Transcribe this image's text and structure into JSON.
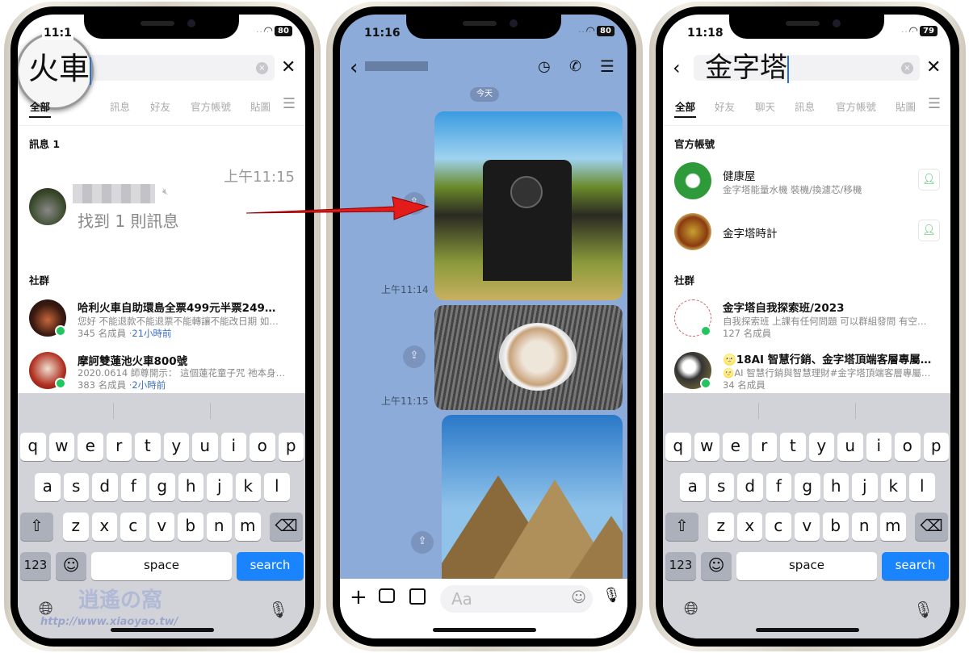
{
  "left": {
    "time": "11:1",
    "battery": "80",
    "query": "火車",
    "tabs": [
      "全部",
      "訊息",
      "好友",
      "官方帳號",
      "貼圖"
    ],
    "messages_header": "訊息 1",
    "message": {
      "time": "上午11:15",
      "summary": "找到 1 則訊息"
    },
    "community_header": "社群",
    "communities": [
      {
        "title": "哈利火車自助環島全票499元半票249…",
        "desc": "您好 不能退款不能退票不能轉讓不能改日期 如…",
        "members": "345 名成員 ·",
        "ago": "21小時前"
      },
      {
        "title": "摩訶雙蓮池火車800號",
        "desc": "2020.0614 師尊開示： 這個蓮花童子咒 祂本身…",
        "members": "383 名成員 ·",
        "ago": "2小時前"
      }
    ]
  },
  "middle": {
    "time": "11:16",
    "battery": "80",
    "date_pill": "今天",
    "times": [
      "上午11:14",
      "上午11:15"
    ],
    "input_placeholder": "Aa"
  },
  "right": {
    "time": "11:18",
    "battery": "79",
    "query": "金字塔",
    "tabs": [
      "全部",
      "好友",
      "聊天",
      "訊息",
      "官方帳號",
      "貼圖"
    ],
    "official_header": "官方帳號",
    "official": [
      {
        "title": "健康屋",
        "desc": "金字塔能量水機 裝機/換濾芯/移機"
      },
      {
        "title": "金字塔時計",
        "desc": ""
      }
    ],
    "community_header": "社群",
    "communities": [
      {
        "title": "金字塔自我探索班/2023",
        "desc": "自我探索班 上課有任何問題 可以群組發問 有空…",
        "members": "127 名成員",
        "ago": ""
      },
      {
        "title": "🌝18AI 智慧行銷、金字塔頂端客層專屬…",
        "desc": "🌝AI 智慧行銷與智慧理財#金字塔頂端客層專屬…",
        "members": "34 名成員",
        "ago": ""
      }
    ]
  },
  "keyboard": {
    "rows": [
      [
        "q",
        "w",
        "e",
        "r",
        "t",
        "y",
        "u",
        "i",
        "o",
        "p"
      ],
      [
        "a",
        "s",
        "d",
        "f",
        "g",
        "h",
        "j",
        "k",
        "l"
      ],
      [
        "z",
        "x",
        "c",
        "v",
        "b",
        "n",
        "m"
      ]
    ],
    "num": "123",
    "space": "space",
    "search": "search"
  },
  "watermark": {
    "text": "逍遙の窩",
    "url": "http://www.xiaoyao.tw/"
  },
  "colors": {
    "accent": "#1a84ff",
    "chat_bg": "#8dabd8",
    "arrow": "#e31b1b",
    "community_badge": "#22c55e"
  }
}
